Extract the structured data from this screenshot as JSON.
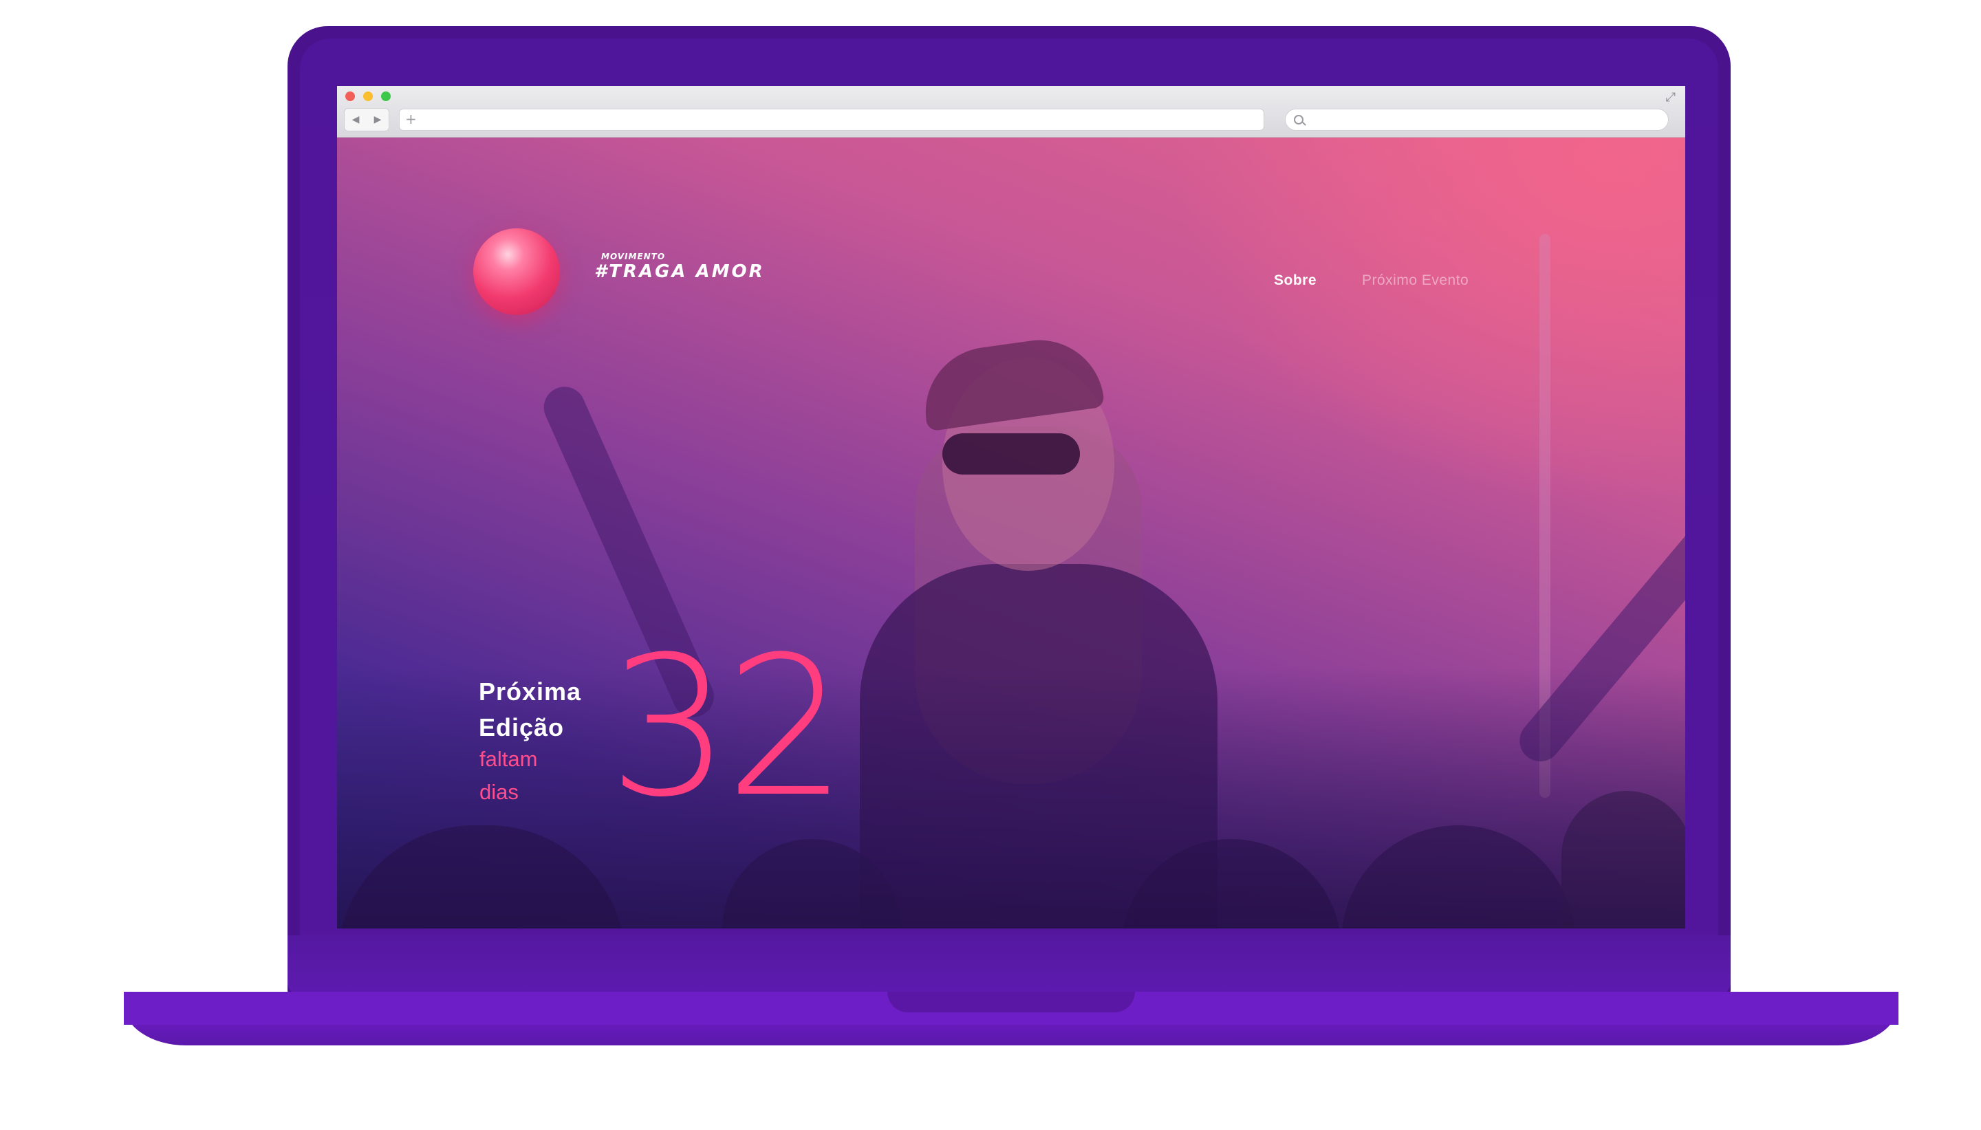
{
  "brand": {
    "small_label": "MOVIMENTO",
    "name": "#TRAGA AMOR"
  },
  "nav": {
    "items": [
      {
        "label": "Sobre",
        "active": true
      },
      {
        "label": "Próximo Evento",
        "active": false
      }
    ]
  },
  "countdown": {
    "title_line1": "Próxima",
    "title_line2": "Edição",
    "sub_line1": "faltam",
    "sub_line2": "dias",
    "days": "32"
  },
  "icons": {
    "back": "back-arrow-icon",
    "forward": "forward-arrow-icon",
    "new_tab": "plus-icon",
    "search": "search-icon",
    "expand": "expand-icon"
  },
  "colors": {
    "accent": "#ff3d7f",
    "laptop": "#4a128c",
    "gradient_top": "#e5648e",
    "gradient_bottom": "#2e2a8f"
  }
}
